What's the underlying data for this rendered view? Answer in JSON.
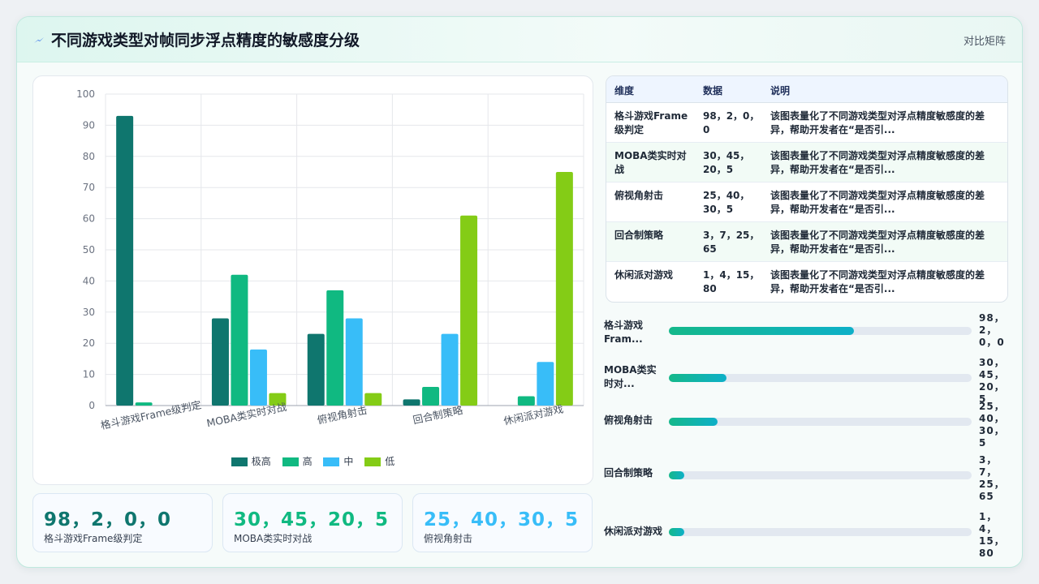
{
  "header": {
    "title": "不同游戏类型对帧同步浮点精度的敏感度分级",
    "tag": "对比矩阵"
  },
  "colors": {
    "very_high": "#0f766e",
    "high": "#10b981",
    "medium": "#38bdf8",
    "low": "#84cc16"
  },
  "chart_data": {
    "type": "bar",
    "categories": [
      "格斗游戏Frame级判定",
      "MOBA类实时对战",
      "俯视角射击",
      "回合制策略",
      "休闲派对游戏"
    ],
    "series": [
      {
        "name": "极高",
        "values": [
          93,
          28,
          23,
          2,
          0
        ],
        "color": "#0f766e"
      },
      {
        "name": "高",
        "values": [
          1,
          42,
          37,
          6,
          3
        ],
        "color": "#10b981"
      },
      {
        "name": "中",
        "values": [
          0,
          18,
          28,
          23,
          14
        ],
        "color": "#38bdf8"
      },
      {
        "name": "低",
        "values": [
          0,
          4,
          4,
          61,
          75
        ],
        "color": "#84cc16"
      }
    ],
    "ylim": [
      0,
      100
    ],
    "yticks": [
      0,
      10,
      20,
      30,
      40,
      50,
      60,
      70,
      80,
      90,
      100
    ],
    "grid": true,
    "legend": "bottom-center"
  },
  "kpis": [
    {
      "value": "98，2，0，0",
      "label": "格斗游戏Frame级判定",
      "color": "#0f766e"
    },
    {
      "value": "30，45，20，5",
      "label": "MOBA类实时对战",
      "color": "#10b981"
    },
    {
      "value": "25，40，30，5",
      "label": "俯视角射击",
      "color": "#38bdf8"
    }
  ],
  "table": {
    "headers": [
      "维度",
      "数据",
      "说明"
    ],
    "rows": [
      {
        "dim": "格斗游戏Frame级判定",
        "data": "98，2，0，0",
        "desc": "该图表量化了不同游戏类型对浮点精度敏感度的差异，帮助开发者在“是否引..."
      },
      {
        "dim": "MOBA类实时对战",
        "data": "30，45，20，5",
        "desc": "该图表量化了不同游戏类型对浮点精度敏感度的差异，帮助开发者在“是否引..."
      },
      {
        "dim": "俯视角射击",
        "data": "25，40，30，5",
        "desc": "该图表量化了不同游戏类型对浮点精度敏感度的差异，帮助开发者在“是否引..."
      },
      {
        "dim": "回合制策略",
        "data": "3，7，25，65",
        "desc": "该图表量化了不同游戏类型对浮点精度敏感度的差异，帮助开发者在“是否引..."
      },
      {
        "dim": "休闲派对游戏",
        "data": "1，4，15，80",
        "desc": "该图表量化了不同游戏类型对浮点精度敏感度的差异，帮助开发者在“是否引..."
      }
    ]
  },
  "progress": [
    {
      "label": "格斗游戏Fram...",
      "value": "98，2，0，0",
      "fill_pct": 61
    },
    {
      "label": "MOBA类实时对...",
      "value": "30，45，20，5",
      "fill_pct": 19
    },
    {
      "label": "俯视角射击",
      "value": "25，40，30，5",
      "fill_pct": 16
    },
    {
      "label": "回合制策略",
      "value": "3，7，25，65",
      "fill_pct": 5
    },
    {
      "label": "休闲派对游戏",
      "value": "1，4，15，80",
      "fill_pct": 5
    }
  ]
}
